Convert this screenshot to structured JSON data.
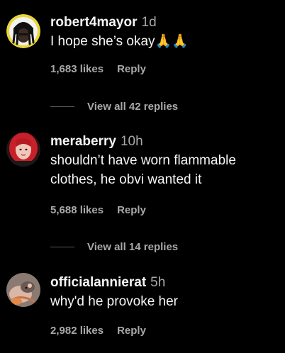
{
  "comments": [
    {
      "username": "robert4mayor",
      "time": "1d",
      "text": "I hope she’s okay🙏🙏",
      "likes": "1,683 likes",
      "reply": "Reply",
      "view_replies": "View all 42 replies",
      "avatar_icon": "profile-photo-dreadlocks"
    },
    {
      "username": "meraberry",
      "time": "10h",
      "text": "shouldn’t have worn flammable clothes, he obvi wanted it",
      "likes": "5,688 likes",
      "reply": "Reply",
      "view_replies": "View all 14 replies",
      "avatar_icon": "profile-photo-red-hair"
    },
    {
      "username": "officialannierat",
      "time": "5h",
      "text": "why'd he provoke her",
      "likes": "2,982 likes",
      "reply": "Reply",
      "avatar_icon": "profile-photo-rat"
    }
  ],
  "colors": {
    "background": "#000000",
    "primary_text": "#f5f5f5",
    "secondary_text": "#a8a8a8"
  }
}
